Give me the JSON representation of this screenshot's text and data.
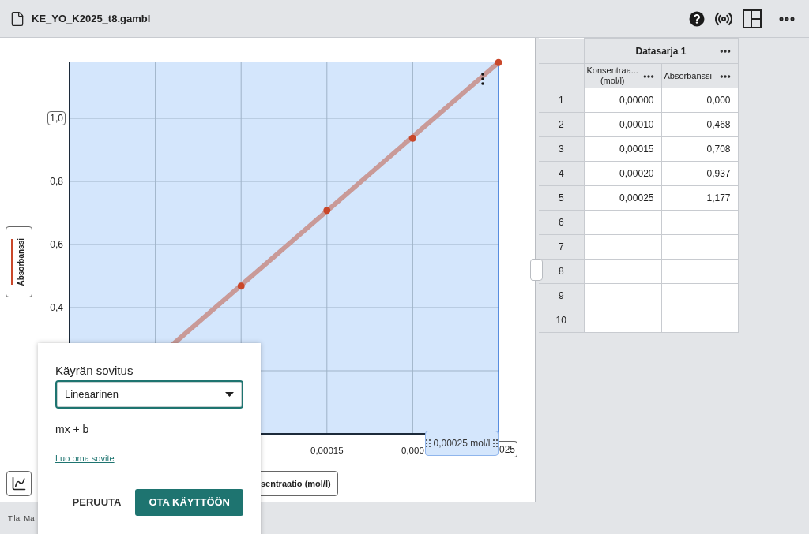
{
  "header": {
    "title": "KE_YO_K2025_t8.gambl"
  },
  "chart": {
    "x_axis_title": "sentraatio (mol/l)",
    "handle_label": "0,00025 mol/l",
    "x_axis_end_label": "025",
    "y_axis_end_boxed": true,
    "chart_data": {
      "type": "scatter",
      "x": [
        0.0001,
        0.00015,
        0.0002,
        0.00025
      ],
      "series": [
        {
          "name": "Absorbanssi",
          "color": "#c9472a",
          "values": [
            0.468,
            0.708,
            0.937,
            1.177
          ]
        }
      ],
      "xlim": [
        0,
        0.00025
      ],
      "ylim": [
        0,
        1.18
      ],
      "grid": true,
      "xticks": [
        {
          "value": 0.00015,
          "label": "0,00015"
        },
        {
          "value": 0.0002,
          "label": "0,000"
        }
      ],
      "yticks": [
        {
          "value": 0.4,
          "label": "0,4"
        },
        {
          "value": 0.6,
          "label": "0,6"
        },
        {
          "value": 0.8,
          "label": "0,8"
        },
        {
          "value": 1.0,
          "label": "1,0"
        }
      ]
    }
  },
  "table": {
    "title": "Datasarja 1",
    "columns": [
      {
        "label": "Konsentraa...",
        "unit": "(mol/l)"
      },
      {
        "label": "Absorbanssi"
      }
    ],
    "rows": [
      {
        "number": "1",
        "cells": [
          "0,00000",
          "0,000"
        ]
      },
      {
        "number": "2",
        "cells": [
          "0,00010",
          "0,468"
        ]
      },
      {
        "number": "3",
        "cells": [
          "0,00015",
          "0,708"
        ]
      },
      {
        "number": "4",
        "cells": [
          "0,00020",
          "0,937"
        ]
      },
      {
        "number": "5",
        "cells": [
          "0,00025",
          "1,177"
        ]
      },
      {
        "number": "6"
      },
      {
        "number": "7"
      },
      {
        "number": "8"
      },
      {
        "number": "9"
      },
      {
        "number": "10"
      }
    ]
  },
  "status_bar": {
    "text": "Tila: Ma"
  },
  "fit_dialog": {
    "title": "Käyrän sovitus",
    "select_value": "Lineaarinen",
    "formula": "mx + b",
    "link": "Luo oma sovite",
    "buttons": [
      {
        "label": "PERUUTA",
        "kind": "text"
      },
      {
        "label": "OTA KÄYTTÖÖN",
        "kind": "primary"
      }
    ]
  }
}
